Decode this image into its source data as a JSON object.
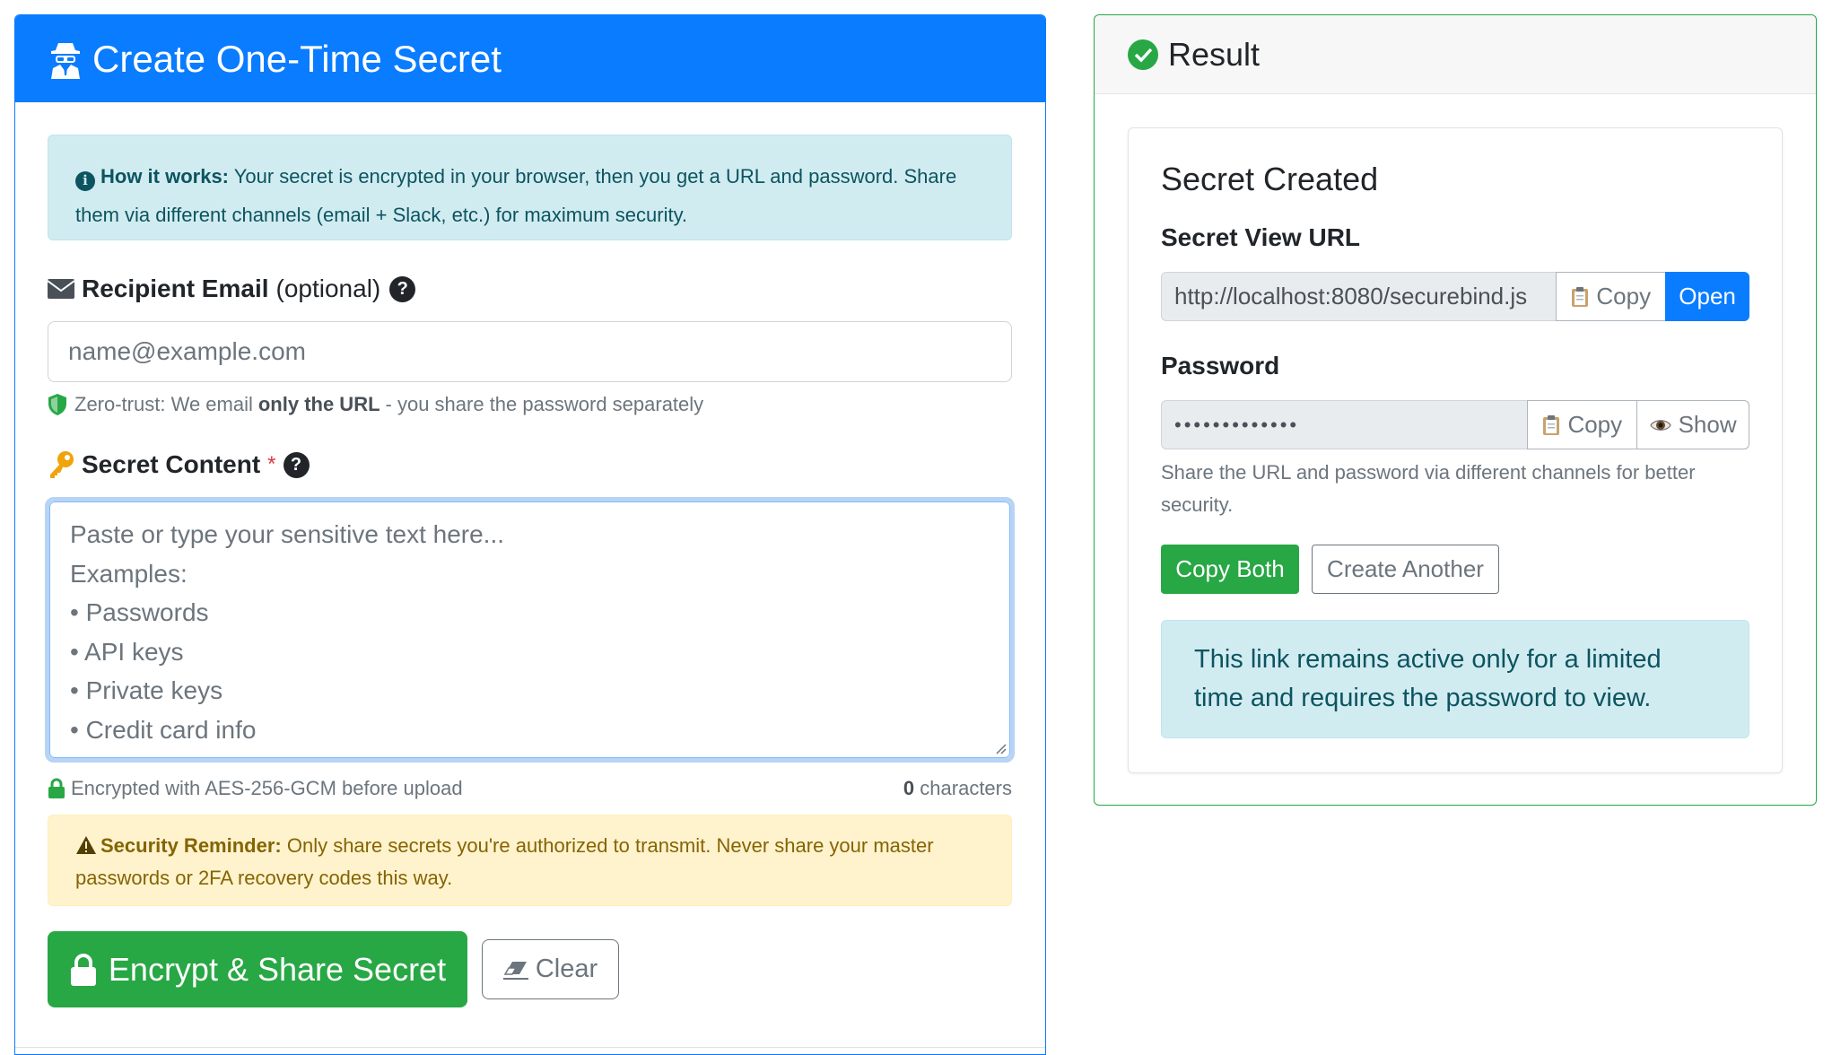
{
  "form": {
    "title": "Create One-Time Secret",
    "title_icon": "user-secret-icon",
    "info": {
      "label": "How it works:",
      "text": " Your secret is encrypted in your browser, then you get a URL and password. Share them via different channels (email + Slack, etc.) for maximum security."
    },
    "email": {
      "label": "Recipient Email",
      "optional": "(optional)",
      "help": "?",
      "placeholder": "name@example.com",
      "hint_prefix": "Zero-trust: We email",
      "hint_bold": "only the URL",
      "hint_suffix": "- you share the password separately"
    },
    "secret": {
      "label": "Secret Content",
      "required_mark": "*",
      "help": "?",
      "placeholder_lines": [
        "Paste or type your sensitive text here...",
        "Examples:",
        "• Passwords",
        "• API keys",
        "• Private keys",
        "• Credit card info"
      ],
      "encryption_note": "Encrypted with AES-256-GCM before upload",
      "char_count": "0",
      "char_label": "characters"
    },
    "warning": {
      "label": "Security Reminder:",
      "text": " Only share secrets you're authorized to transmit. Never share your master passwords or 2FA recovery codes this way."
    },
    "submit_label": "Encrypt & Share Secret",
    "clear_label": "Clear"
  },
  "result": {
    "title": "Result",
    "heading": "Secret Created",
    "url_label": "Secret View URL",
    "url_value": "http://localhost:8080/securebind.js",
    "copy_label": "Copy",
    "open_label": "Open",
    "password_label": "Password",
    "password_mask": "•••••••••••••",
    "show_label": "Show",
    "share_hint": "Share the URL and password via different channels for better security.",
    "copy_both_label": "Copy Both",
    "create_another_label": "Create Another",
    "limit_text": "This link remains active only for a limited time and requires the password to view."
  },
  "colors": {
    "primary": "#0a7cff",
    "success": "#28a745",
    "info_bg": "#d1ecf1",
    "warning_bg": "#fff3cd"
  }
}
